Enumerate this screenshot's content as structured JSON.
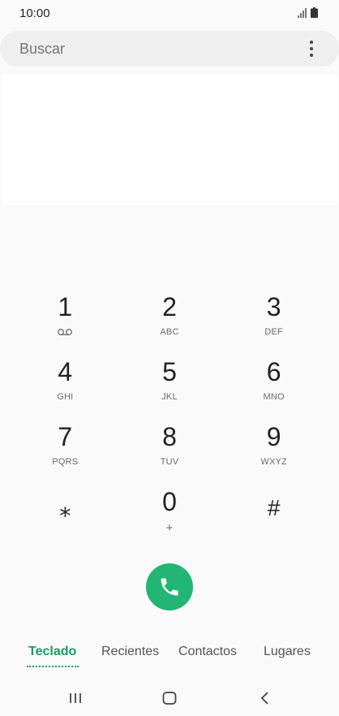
{
  "status": {
    "time": "10:00"
  },
  "search": {
    "placeholder": "Buscar"
  },
  "keypad": {
    "keys": [
      {
        "digit": "1",
        "letters": ""
      },
      {
        "digit": "2",
        "letters": "ABC"
      },
      {
        "digit": "3",
        "letters": "DEF"
      },
      {
        "digit": "4",
        "letters": "GHI"
      },
      {
        "digit": "5",
        "letters": "JKL"
      },
      {
        "digit": "6",
        "letters": "MNO"
      },
      {
        "digit": "7",
        "letters": "PQRS"
      },
      {
        "digit": "8",
        "letters": "TUV"
      },
      {
        "digit": "9",
        "letters": "WXYZ"
      },
      {
        "digit": "⁎",
        "letters": ""
      },
      {
        "digit": "0",
        "letters": "+"
      },
      {
        "digit": "#",
        "letters": ""
      }
    ]
  },
  "tabs": [
    {
      "label": "Teclado"
    },
    {
      "label": "Recientes"
    },
    {
      "label": "Contactos"
    },
    {
      "label": "Lugares"
    }
  ],
  "colors": {
    "accent": "#1c9c63",
    "call": "#22b573"
  }
}
